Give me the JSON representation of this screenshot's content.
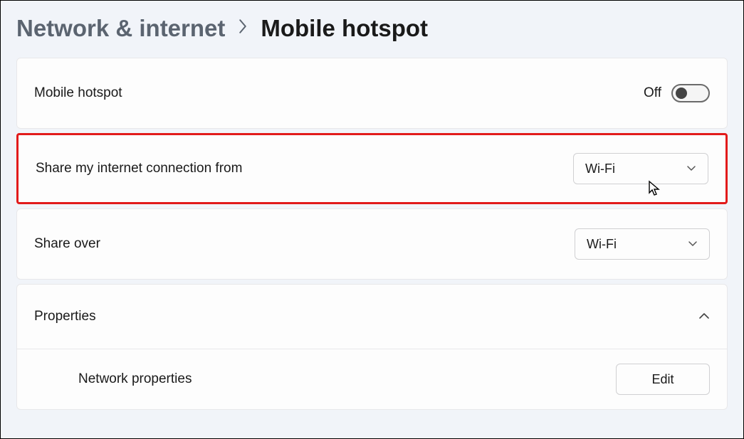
{
  "breadcrumb": {
    "parent": "Network & internet",
    "current": "Mobile hotspot"
  },
  "rows": {
    "hotspot": {
      "label": "Mobile hotspot",
      "state_text": "Off"
    },
    "share_from": {
      "label": "Share my internet connection from",
      "value": "Wi-Fi"
    },
    "share_over": {
      "label": "Share over",
      "value": "Wi-Fi"
    },
    "properties": {
      "label": "Properties",
      "child_label": "Network properties",
      "edit_label": "Edit"
    }
  }
}
